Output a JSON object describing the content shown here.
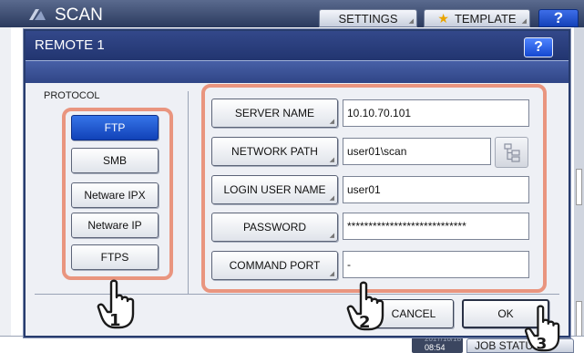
{
  "app": {
    "title": "SCAN",
    "settings_label": "SETTINGS",
    "template_label": "TEMPLATE",
    "help_label": "?",
    "date_text": "2017/10/18",
    "time_text": "08:54",
    "jobs_label": "JOB STATUS"
  },
  "dialog": {
    "title": "REMOTE 1",
    "help_label": "?",
    "protocol_label": "PROTOCOL",
    "protocols": [
      "FTP",
      "SMB",
      "Netware IPX",
      "Netware IP",
      "FTPS"
    ],
    "selected_protocol": "FTP",
    "fields": {
      "server_name": {
        "label": "SERVER NAME",
        "value": "10.10.70.101"
      },
      "network_path": {
        "label": "NETWORK PATH",
        "value": "user01\\scan"
      },
      "login_user_name": {
        "label": "LOGIN USER NAME",
        "value": "user01"
      },
      "password": {
        "label": "PASSWORD",
        "value": "****************************"
      },
      "command_port": {
        "label": "COMMAND PORT",
        "value": "-"
      }
    },
    "cancel_label": "CANCEL",
    "ok_label": "OK"
  },
  "callouts": {
    "step1": "1",
    "step2": "2",
    "step3": "3"
  },
  "colors": {
    "highlight": "#e9957f",
    "selected": "#1f56cf",
    "header": "#283c6e"
  }
}
